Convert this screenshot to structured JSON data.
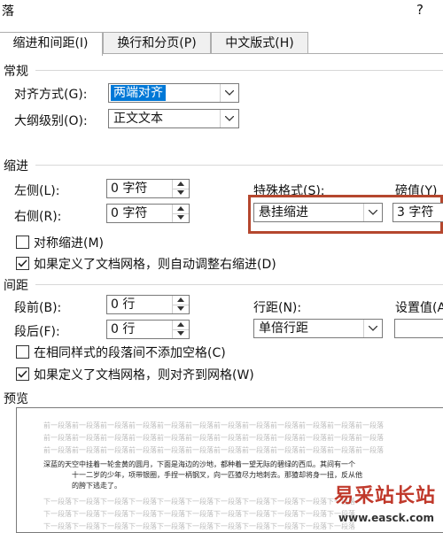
{
  "dialog": {
    "title": "落",
    "help": "?"
  },
  "tabs": [
    {
      "label": "缩进和间距(I)"
    },
    {
      "label": "换行和分页(P)"
    },
    {
      "label": "中文版式(H)"
    }
  ],
  "general": {
    "heading": "常规",
    "alignment_label": "对齐方式(G):",
    "alignment_value": "两端对齐",
    "outline_label": "大纲级别(O):",
    "outline_value": "正文文本"
  },
  "indent": {
    "heading": "缩进",
    "left_label": "左侧(L):",
    "left_value": "0 字符",
    "right_label": "右侧(R):",
    "right_value": "0 字符",
    "special_label": "特殊格式(S):",
    "special_value": "悬挂缩进",
    "by_label": "磅值(Y)",
    "by_value": "3 字符",
    "mirror_label": "对称缩进(M)",
    "auto_adjust_label": "如果定义了文档网格，则自动调整右缩进(D)"
  },
  "spacing": {
    "heading": "间距",
    "before_label": "段前(B):",
    "before_value": "0 行",
    "after_label": "段后(F):",
    "after_value": "0 行",
    "line_spacing_label": "行距(N):",
    "line_spacing_value": "单倍行距",
    "at_label": "设置值(A",
    "no_space_label": "在相同样式的段落间不添加空格(C)",
    "snap_grid_label": "如果定义了文档网格，则对齐到网格(W)"
  },
  "preview": {
    "heading": "预览",
    "prev_lines": [
      "前一段落前一段落前一段落前一段落前一段落前一段落前一段落前一段落前一段落前一段落前一段落前一段落",
      "前一段落前一段落前一段落前一段落前一段落前一段落前一段落前一段落前一段落前一段落前一段落前一段落",
      "前一段落前一段落前一段落前一段落前一段落前一段落前一段落前一段落前一段落前一段落前一段落前一段落"
    ],
    "main_lines": [
      "深蓝的天空中挂着一轮金黄的圆月，下面是海边的沙地，都种着一望无际的碧绿的西瓜。其间有一个",
      "十一二岁的少年，项带银圈，手捏一柄钢叉，向一匹猹尽力地刺去。那猹却将身一扭，反从他",
      "的胯下逃走了。"
    ],
    "next_lines": [
      "下一段落下一段落下一段落下一段落下一段落下一段落下一段落下一段落下一段落下一段落下一段落",
      "下一段落下一段落下一段落下一段落下一段落下一段落下一段落下一段落下一段落下一段落下一段落",
      "下一段落下一段落下一段落下一段落下一段落下一段落下一段落下一段落下一段落下一段落下一段落"
    ]
  },
  "watermark": {
    "text": "易采站长站",
    "url": "www.easck.com"
  }
}
